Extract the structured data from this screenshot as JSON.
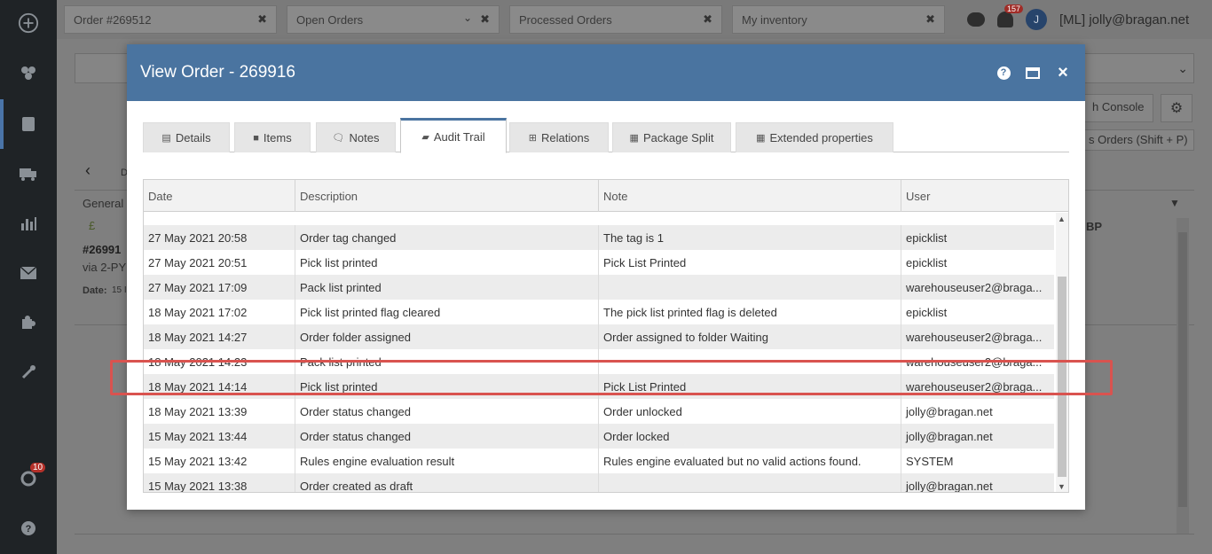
{
  "app": {
    "nav_badge": "10",
    "open_tabs": [
      {
        "label": "Order #269512"
      },
      {
        "label": "Open Orders"
      },
      {
        "label": "Processed Orders"
      },
      {
        "label": "My inventory"
      }
    ],
    "notifications_count": "157",
    "user_initial": "J",
    "user_label": "[ML] jolly@bragan.net",
    "background": {
      "btn_console": "h Console",
      "btn_orders": "s Orders (Shift + P)",
      "general_label": "General",
      "order_number": "#26991",
      "order_via": "via 2-PY",
      "date_label": "Date:",
      "date_value": "15 I",
      "gbp_label": "BP",
      "back_arrow": "‹",
      "d_letter": "D"
    }
  },
  "modal": {
    "title": "View Order - 269916",
    "tabs": [
      {
        "label": "Details",
        "icon": "list-icon"
      },
      {
        "label": "Items",
        "icon": "square-icon"
      },
      {
        "label": "Notes",
        "icon": "comments-icon"
      },
      {
        "label": "Audit Trail",
        "icon": "archive-icon"
      },
      {
        "label": "Relations",
        "icon": "sitemap-icon"
      },
      {
        "label": "Package Split",
        "icon": "grid-icon"
      },
      {
        "label": "Extended properties",
        "icon": "grid-icon"
      }
    ],
    "active_tab": "Audit Trail",
    "columns": {
      "date": "Date",
      "description": "Description",
      "note": "Note",
      "user": "User"
    },
    "rows": [
      {
        "date": "27 May 2021 20:58",
        "description": "Order tag changed",
        "note": "The tag is 1",
        "user": "epicklist"
      },
      {
        "date": "27 May 2021 20:51",
        "description": "Pick list printed",
        "note": "Pick List Printed",
        "user": "epicklist"
      },
      {
        "date": "27 May 2021 17:09",
        "description": "Pack list printed",
        "note": "",
        "user": "warehouseuser2@braga..."
      },
      {
        "date": "18 May 2021 17:02",
        "description": "Pick list printed flag cleared",
        "note": "The pick list printed flag is deleted",
        "user": "epicklist"
      },
      {
        "date": "18 May 2021 14:27",
        "description": "Order folder assigned",
        "note": "Order assigned to folder Waiting",
        "user": "warehouseuser2@braga..."
      },
      {
        "date": "18 May 2021 14:23",
        "description": "Pack list printed",
        "note": "",
        "user": "warehouseuser2@braga..."
      },
      {
        "date": "18 May 2021 14:14",
        "description": "Pick list printed",
        "note": "Pick List Printed",
        "user": "warehouseuser2@braga..."
      },
      {
        "date": "18 May 2021 13:39",
        "description": "Order status changed",
        "note": "Order unlocked",
        "user": "jolly@bragan.net"
      },
      {
        "date": "15 May 2021 13:44",
        "description": "Order status changed",
        "note": "Order locked",
        "user": "jolly@bragan.net"
      },
      {
        "date": "15 May 2021 13:42",
        "description": "Rules engine evaluation result",
        "note": "Rules engine evaluated but no valid actions found.",
        "user": "SYSTEM"
      },
      {
        "date": "15 May 2021 13:38",
        "description": "Order created as draft",
        "note": "",
        "user": "jolly@bragan.net"
      }
    ],
    "highlighted_row_index": 6
  },
  "colors": {
    "header": "#4a74a0",
    "highlight": "#d9534f",
    "overlay": "#7f7f7f",
    "nav": "#1f2326"
  }
}
